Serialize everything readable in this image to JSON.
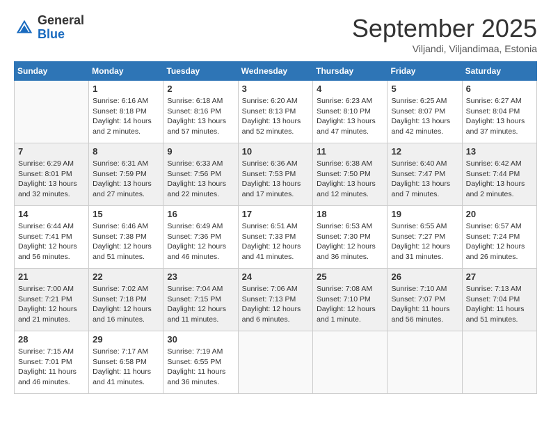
{
  "logo": {
    "general": "General",
    "blue": "Blue"
  },
  "title": {
    "month": "September 2025",
    "location": "Viljandi, Viljandimaa, Estonia"
  },
  "days_of_week": [
    "Sunday",
    "Monday",
    "Tuesday",
    "Wednesday",
    "Thursday",
    "Friday",
    "Saturday"
  ],
  "weeks": [
    [
      {
        "day": "",
        "info": ""
      },
      {
        "day": "1",
        "info": "Sunrise: 6:16 AM\nSunset: 8:18 PM\nDaylight: 14 hours\nand 2 minutes."
      },
      {
        "day": "2",
        "info": "Sunrise: 6:18 AM\nSunset: 8:16 PM\nDaylight: 13 hours\nand 57 minutes."
      },
      {
        "day": "3",
        "info": "Sunrise: 6:20 AM\nSunset: 8:13 PM\nDaylight: 13 hours\nand 52 minutes."
      },
      {
        "day": "4",
        "info": "Sunrise: 6:23 AM\nSunset: 8:10 PM\nDaylight: 13 hours\nand 47 minutes."
      },
      {
        "day": "5",
        "info": "Sunrise: 6:25 AM\nSunset: 8:07 PM\nDaylight: 13 hours\nand 42 minutes."
      },
      {
        "day": "6",
        "info": "Sunrise: 6:27 AM\nSunset: 8:04 PM\nDaylight: 13 hours\nand 37 minutes."
      }
    ],
    [
      {
        "day": "7",
        "info": "Sunrise: 6:29 AM\nSunset: 8:01 PM\nDaylight: 13 hours\nand 32 minutes."
      },
      {
        "day": "8",
        "info": "Sunrise: 6:31 AM\nSunset: 7:59 PM\nDaylight: 13 hours\nand 27 minutes."
      },
      {
        "day": "9",
        "info": "Sunrise: 6:33 AM\nSunset: 7:56 PM\nDaylight: 13 hours\nand 22 minutes."
      },
      {
        "day": "10",
        "info": "Sunrise: 6:36 AM\nSunset: 7:53 PM\nDaylight: 13 hours\nand 17 minutes."
      },
      {
        "day": "11",
        "info": "Sunrise: 6:38 AM\nSunset: 7:50 PM\nDaylight: 13 hours\nand 12 minutes."
      },
      {
        "day": "12",
        "info": "Sunrise: 6:40 AM\nSunset: 7:47 PM\nDaylight: 13 hours\nand 7 minutes."
      },
      {
        "day": "13",
        "info": "Sunrise: 6:42 AM\nSunset: 7:44 PM\nDaylight: 13 hours\nand 2 minutes."
      }
    ],
    [
      {
        "day": "14",
        "info": "Sunrise: 6:44 AM\nSunset: 7:41 PM\nDaylight: 12 hours\nand 56 minutes."
      },
      {
        "day": "15",
        "info": "Sunrise: 6:46 AM\nSunset: 7:38 PM\nDaylight: 12 hours\nand 51 minutes."
      },
      {
        "day": "16",
        "info": "Sunrise: 6:49 AM\nSunset: 7:36 PM\nDaylight: 12 hours\nand 46 minutes."
      },
      {
        "day": "17",
        "info": "Sunrise: 6:51 AM\nSunset: 7:33 PM\nDaylight: 12 hours\nand 41 minutes."
      },
      {
        "day": "18",
        "info": "Sunrise: 6:53 AM\nSunset: 7:30 PM\nDaylight: 12 hours\nand 36 minutes."
      },
      {
        "day": "19",
        "info": "Sunrise: 6:55 AM\nSunset: 7:27 PM\nDaylight: 12 hours\nand 31 minutes."
      },
      {
        "day": "20",
        "info": "Sunrise: 6:57 AM\nSunset: 7:24 PM\nDaylight: 12 hours\nand 26 minutes."
      }
    ],
    [
      {
        "day": "21",
        "info": "Sunrise: 7:00 AM\nSunset: 7:21 PM\nDaylight: 12 hours\nand 21 minutes."
      },
      {
        "day": "22",
        "info": "Sunrise: 7:02 AM\nSunset: 7:18 PM\nDaylight: 12 hours\nand 16 minutes."
      },
      {
        "day": "23",
        "info": "Sunrise: 7:04 AM\nSunset: 7:15 PM\nDaylight: 12 hours\nand 11 minutes."
      },
      {
        "day": "24",
        "info": "Sunrise: 7:06 AM\nSunset: 7:13 PM\nDaylight: 12 hours\nand 6 minutes."
      },
      {
        "day": "25",
        "info": "Sunrise: 7:08 AM\nSunset: 7:10 PM\nDaylight: 12 hours\nand 1 minute."
      },
      {
        "day": "26",
        "info": "Sunrise: 7:10 AM\nSunset: 7:07 PM\nDaylight: 11 hours\nand 56 minutes."
      },
      {
        "day": "27",
        "info": "Sunrise: 7:13 AM\nSunset: 7:04 PM\nDaylight: 11 hours\nand 51 minutes."
      }
    ],
    [
      {
        "day": "28",
        "info": "Sunrise: 7:15 AM\nSunset: 7:01 PM\nDaylight: 11 hours\nand 46 minutes."
      },
      {
        "day": "29",
        "info": "Sunrise: 7:17 AM\nSunset: 6:58 PM\nDaylight: 11 hours\nand 41 minutes."
      },
      {
        "day": "30",
        "info": "Sunrise: 7:19 AM\nSunset: 6:55 PM\nDaylight: 11 hours\nand 36 minutes."
      },
      {
        "day": "",
        "info": ""
      },
      {
        "day": "",
        "info": ""
      },
      {
        "day": "",
        "info": ""
      },
      {
        "day": "",
        "info": ""
      }
    ]
  ]
}
